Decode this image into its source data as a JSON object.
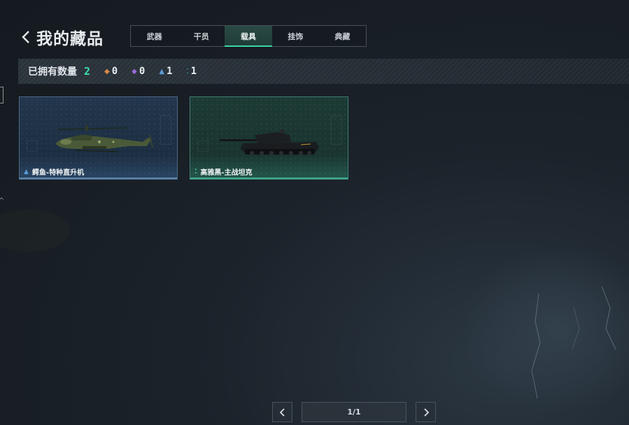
{
  "header": {
    "title": "我的藏品"
  },
  "tabs": [
    {
      "label": "武器",
      "active": false
    },
    {
      "label": "干员",
      "active": false
    },
    {
      "label": "载具",
      "active": true
    },
    {
      "label": "挂饰",
      "active": false
    },
    {
      "label": "典藏",
      "active": false
    }
  ],
  "stats": {
    "label": "已拥有数量",
    "total": "2",
    "rarities": [
      {
        "icon": "orange-diamond-icon",
        "color": "#d98a4a",
        "count": "0"
      },
      {
        "icon": "purple-diamond-icon",
        "color": "#9a6ad8",
        "count": "0"
      },
      {
        "icon": "blue-triangle-icon",
        "color": "#5a9ad8",
        "count": "1"
      },
      {
        "icon": "green-dots-icon",
        "color": "#3be0a8",
        "count": "1"
      }
    ]
  },
  "items": [
    {
      "name": "鳄鱼-特种直升机",
      "rarity_icon": "blue-triangle-icon",
      "rarity_color": "#5a9ad8",
      "image": "attack-helicopter"
    },
    {
      "name": "高雅黑-主战坦克",
      "rarity_icon": "green-dots-icon",
      "rarity_color": "#3be0a8",
      "image": "main-battle-tank"
    }
  ],
  "pager": {
    "text": "1/1"
  },
  "colors": {
    "accent": "#3ad6a5"
  }
}
